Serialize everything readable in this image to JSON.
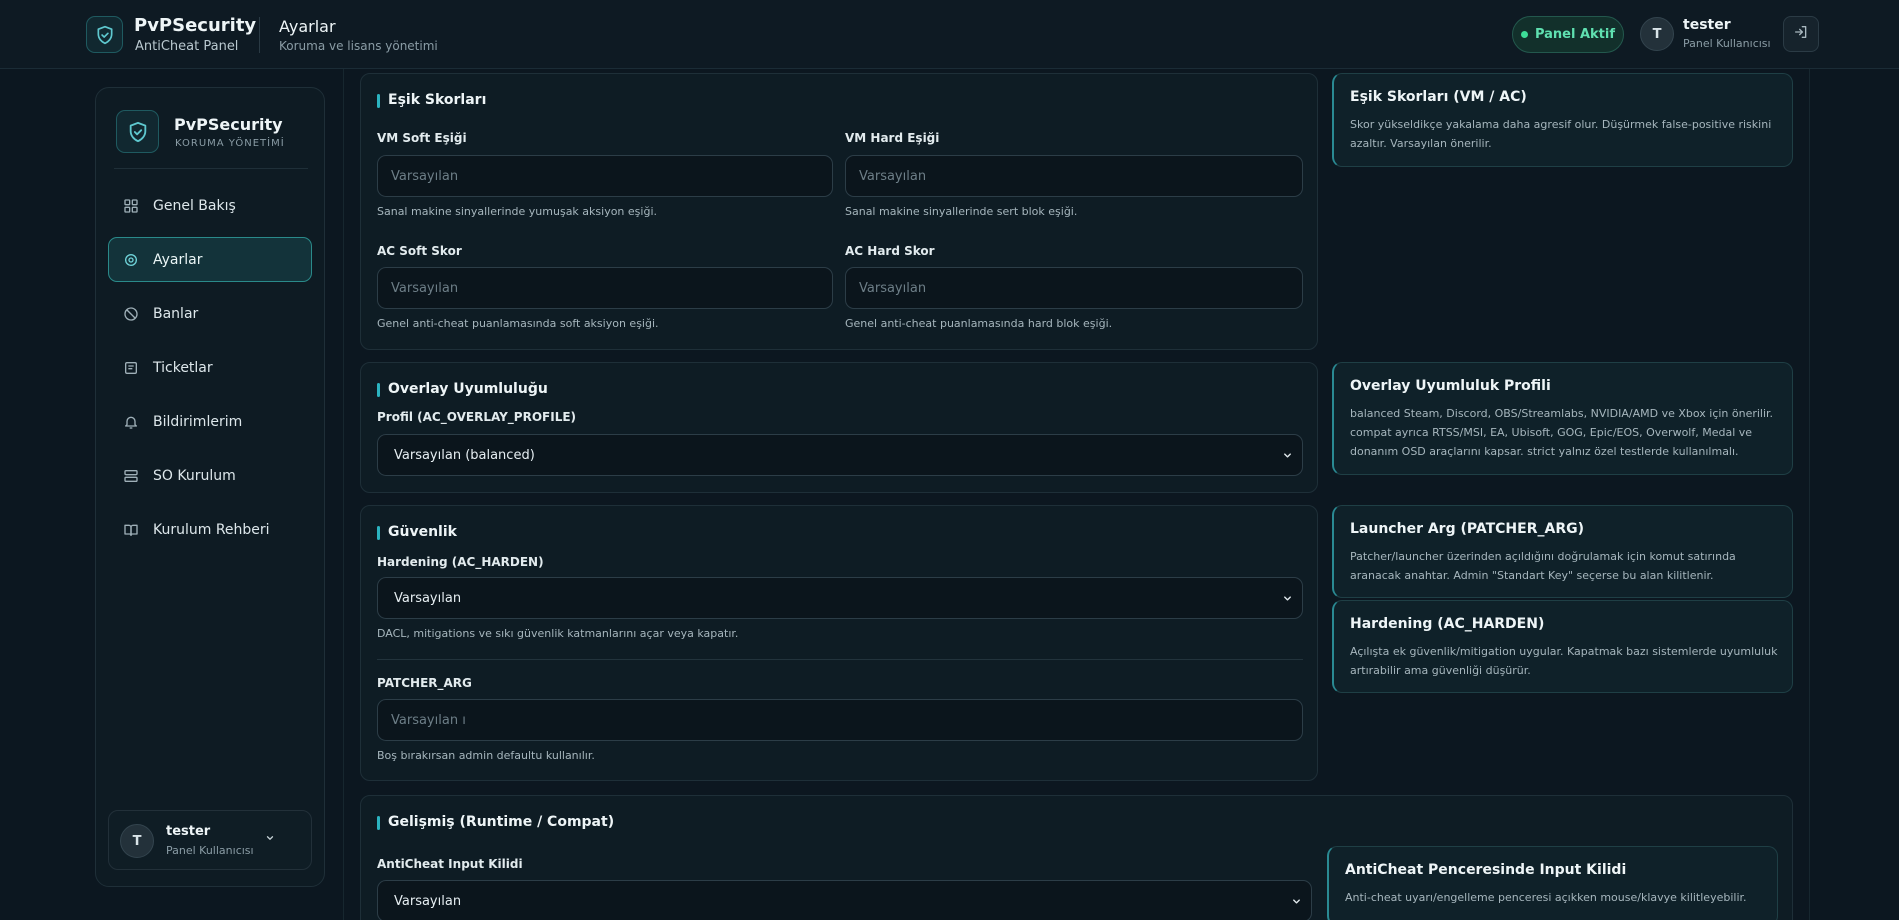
{
  "header": {
    "brand_title": "PvPSecurity",
    "brand_sub": "AntiCheat Panel",
    "page_title": "Ayarlar",
    "page_sub": "Koruma ve lisans yönetimi",
    "status": "Panel Aktif",
    "avatar_initial": "T",
    "user_name": "tester",
    "user_role": "Panel Kullanıcısı"
  },
  "sidebar": {
    "title": "PvPSecurity",
    "subtitle": "KORUMA YÖNETİMİ",
    "items": [
      {
        "label": "Genel Bakış",
        "icon": "grid-icon",
        "active": false
      },
      {
        "label": "Ayarlar",
        "icon": "gear-icon",
        "active": true
      },
      {
        "label": "Banlar",
        "icon": "ban-icon",
        "active": false
      },
      {
        "label": "Ticketlar",
        "icon": "ticket-icon",
        "active": false
      },
      {
        "label": "Bildirimlerim",
        "icon": "bell-icon",
        "active": false
      },
      {
        "label": "SO Kurulum",
        "icon": "server-icon",
        "active": false
      },
      {
        "label": "Kurulum Rehberi",
        "icon": "book-icon",
        "active": false
      }
    ],
    "user": {
      "initial": "T",
      "name": "tester",
      "role": "Panel Kullanıcısı"
    }
  },
  "thresholds": {
    "title": "Eşik Skorları",
    "fields": [
      {
        "label": "VM Soft Eşiği",
        "placeholder": "Varsayılan",
        "help": "Sanal makine sinyallerinde yumuşak aksiyon eşiği."
      },
      {
        "label": "VM Hard Eşiği",
        "placeholder": "Varsayılan",
        "help": "Sanal makine sinyallerinde sert blok eşiği."
      },
      {
        "label": "AC Soft Skor",
        "placeholder": "Varsayılan",
        "help": "Genel anti-cheat puanlamasında soft aksiyon eşiği."
      },
      {
        "label": "AC Hard Skor",
        "placeholder": "Varsayılan",
        "help": "Genel anti-cheat puanlamasında hard blok eşiği."
      }
    ],
    "info_title": "Eşik Skorları (VM / AC)",
    "info_text": "Skor yükseldikçe yakalama daha agresif olur. Düşürmek false-positive riskini azaltır. Varsayılan önerilir."
  },
  "overlay": {
    "title": "Overlay Uyumluluğu",
    "label": "Profil (AC_OVERLAY_PROFILE)",
    "value": "Varsayılan (balanced)",
    "info_title": "Overlay Uyumluluk Profili",
    "info_text": "balanced Steam, Discord, OBS/Streamlabs, NVIDIA/AMD ve Xbox için önerilir. compat ayrıca RTSS/MSI, EA, Ubisoft, GOG, Epic/EOS, Overwolf, Medal ve donanım OSD araçlarını kapsar. strict yalnız özel testlerde kullanılmalı."
  },
  "security": {
    "title": "Güvenlik",
    "harden_label": "Hardening (AC_HARDEN)",
    "harden_value": "Varsayılan",
    "harden_help": "DACL, mitigations ve sıkı güvenlik katmanlarını açar veya kapatır.",
    "patcher_label": "PATCHER_ARG",
    "patcher_placeholder": "Varsayılan ı",
    "patcher_help": "Boş bırakırsan admin defaultu kullanılır.",
    "info1_title": "Launcher Arg (PATCHER_ARG)",
    "info1_text": "Patcher/launcher üzerinden açıldığını doğrulamak için komut satırında aranacak anahtar. Admin \"Standart Key\" seçerse bu alan kilitlenir.",
    "info2_title": "Hardening (AC_HARDEN)",
    "info2_text": "Açılışta ek güvenlik/mitigation uygular. Kapatmak bazı sistemlerde uyumluluk artırabilir ama güvenliği düşürür."
  },
  "advanced": {
    "title": "Gelişmiş (Runtime / Compat)",
    "label": "AntiCheat Input Kilidi",
    "value": "Varsayılan",
    "info_title": "AntiCheat Penceresinde Input Kilidi",
    "info_text": "Anti-cheat uyarı/engelleme penceresi açıkken mouse/klavye kilitleyebilir."
  },
  "colors": {
    "accent": "#2bb3c0",
    "status_green": "#3ddc97",
    "background": "#0c1720"
  }
}
